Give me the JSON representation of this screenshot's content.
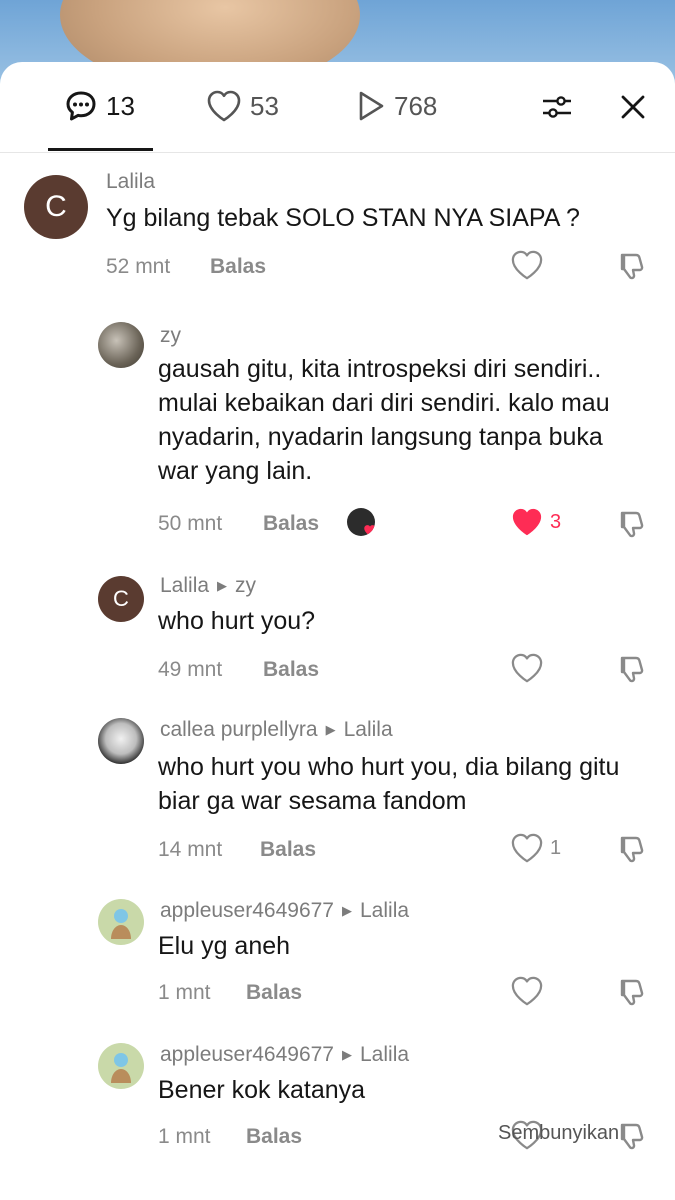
{
  "stats": {
    "comments": "13",
    "likes": "53",
    "views": "768"
  },
  "comments": [
    {
      "user": "Lalila",
      "reply_to": "",
      "avatar_letter": "C",
      "text": "Yg bilang tebak SOLO STAN NYA SIAPA ?",
      "time": "52 mnt",
      "reply": "Balas",
      "likes": ""
    },
    {
      "user": "zy",
      "reply_to": "",
      "text": "gausah gitu, kita introspeksi diri sendiri.. mulai kebaikan dari diri sendiri. kalo mau nyadarin, nyadarin langsung tanpa buka war yang lain.",
      "time": "50 mnt",
      "reply": "Balas",
      "likes": "3"
    },
    {
      "user": "Lalila",
      "reply_to": "zy",
      "avatar_letter": "C",
      "text": "who hurt you?",
      "time": "49 mnt",
      "reply": "Balas",
      "likes": ""
    },
    {
      "user": "callea purplellyra",
      "reply_to": "Lalila",
      "text": "who hurt you who hurt you, dia bilang gitu biar ga war sesama fandom",
      "time": "14 mnt",
      "reply": "Balas",
      "likes": "1"
    },
    {
      "user": "appleuser4649677",
      "reply_to": "Lalila",
      "text": "Elu yg aneh",
      "time": "1 mnt",
      "reply": "Balas",
      "likes": ""
    },
    {
      "user": "appleuser4649677",
      "reply_to": "Lalila",
      "text": "Bener kok katanya",
      "time": "1 mnt",
      "reply": "Balas",
      "likes": ""
    }
  ],
  "hide_label": "Sembunyikan",
  "colors": {
    "avatar_brown": "#5a3b30",
    "heart_red": "#fe2c55"
  }
}
